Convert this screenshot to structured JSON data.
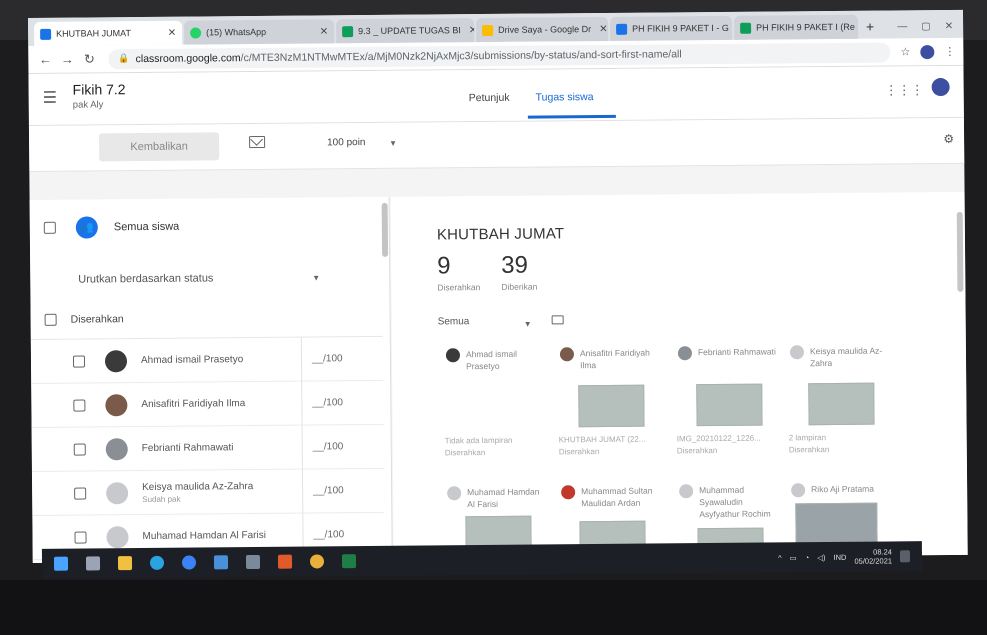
{
  "browser": {
    "tabs": [
      {
        "label": "KHUTBAH JUMAT",
        "color": "#1a73e8",
        "active": true
      },
      {
        "label": "(15) WhatsApp",
        "color": "#25d366",
        "active": false
      },
      {
        "label": "9.3 _ UPDATE TUGAS BI",
        "color": "#0f9d58",
        "active": false
      },
      {
        "label": "Drive Saya - Google Dr",
        "color": "#fbbc04",
        "active": false
      },
      {
        "label": "PH FIKIH 9 PAKET I - G",
        "color": "#1a73e8",
        "active": false
      },
      {
        "label": "PH FIKIH 9 PAKET I (Re",
        "color": "#0f9d58",
        "active": false
      }
    ],
    "new_tab": "+",
    "url_host": "classroom.google.com",
    "url_path": "/c/MTE3NzM1NTMwMTEx/a/MjM0Nzk2NjAxMjc3/submissions/by-status/and-sort-first-name/all"
  },
  "header": {
    "class_name": "Fikih 7.2",
    "teacher": "pak Aly",
    "tab_instructions": "Petunjuk",
    "tab_student_work": "Tugas siswa"
  },
  "toolbar": {
    "return_label": "Kembalikan",
    "points": "100 poin"
  },
  "left": {
    "all_students": "Semua siswa",
    "sort_label": "Urutkan berdasarkan status",
    "section_label": "Diserahkan",
    "students": [
      {
        "name": "Ahmad ismail Prasetyo",
        "sub": "",
        "grade": "__/100",
        "avatar_color": "#3a3a3a"
      },
      {
        "name": "Anisafitri Faridiyah Ilma",
        "sub": "",
        "grade": "__/100",
        "avatar_color": "#7a5a4a"
      },
      {
        "name": "Febrianti Rahmawati",
        "sub": "",
        "grade": "__/100",
        "avatar_color": "#8a8f96"
      },
      {
        "name": "Keisya maulida Az-Zahra",
        "sub": "Sudah pak",
        "grade": "__/100",
        "avatar_color": "#c7c9cc"
      },
      {
        "name": "Muhamad Hamdan Al Farisi",
        "sub": "",
        "grade": "__/100",
        "avatar_color": "#c7c9cc"
      }
    ]
  },
  "right": {
    "assignment_title": "KHUTBAH JUMAT",
    "turned_in_count": "9",
    "turned_in_label": "Diserahkan",
    "assigned_count": "39",
    "assigned_label": "Diberikan",
    "filter": "Semua",
    "cards": [
      {
        "name": "Ahmad ismail Prasetyo",
        "attachment": "Tidak ada lampiran",
        "status": "Diserahkan",
        "avatar_color": "#3a3a3a",
        "thumb": false
      },
      {
        "name": "Anisafitri Faridiyah Ilma",
        "attachment": "KHUTBAH JUMAT (22...",
        "status": "Diserahkan",
        "avatar_color": "#7a5a4a",
        "thumb": true
      },
      {
        "name": "Febrianti Rahmawati",
        "attachment": "IMG_20210122_1226...",
        "status": "Diserahkan",
        "avatar_color": "#8a8f96",
        "thumb": true
      },
      {
        "name": "Keisya maulida Az-Zahra",
        "attachment": "2 lampiran",
        "status": "Diserahkan",
        "avatar_color": "#c7c9cc",
        "thumb": true
      },
      {
        "name": "Muhamad Hamdan Al Farisi",
        "attachment": "",
        "status": "",
        "avatar_color": "#c7c9cc",
        "thumb": true
      },
      {
        "name": "Muhammad Sultan Maulidan Ardan",
        "attachment": "",
        "status": "",
        "avatar_color": "#c0392b",
        "thumb": true
      },
      {
        "name": "Muhammad Syawaludin Asyfyathur Rochim",
        "attachment": "",
        "status": "",
        "avatar_color": "#c7c9cc",
        "thumb": true
      },
      {
        "name": "Riko Aji Pratama",
        "attachment": "",
        "status": "",
        "avatar_color": "#c7c9cc",
        "thumb": true
      }
    ]
  },
  "taskbar": {
    "icons": [
      {
        "name": "windows-start-icon",
        "color": "#4aa3ff"
      },
      {
        "name": "task-view-icon",
        "color": "#9aa4b5"
      },
      {
        "name": "file-explorer-icon",
        "color": "#f0c040"
      },
      {
        "name": "edge-icon",
        "color": "#2aa3e0"
      },
      {
        "name": "maps-icon",
        "color": "#3b82f6"
      },
      {
        "name": "store-icon",
        "color": "#4a90d9"
      },
      {
        "name": "camera-icon",
        "color": "#7a8a9a"
      },
      {
        "name": "office-icon",
        "color": "#e05a2a"
      },
      {
        "name": "chrome-icon",
        "color": "#e8b23a"
      },
      {
        "name": "excel-icon",
        "color": "#1e7e45"
      }
    ],
    "lang": "IND",
    "time": "08.24",
    "date": "05/02/2021"
  }
}
